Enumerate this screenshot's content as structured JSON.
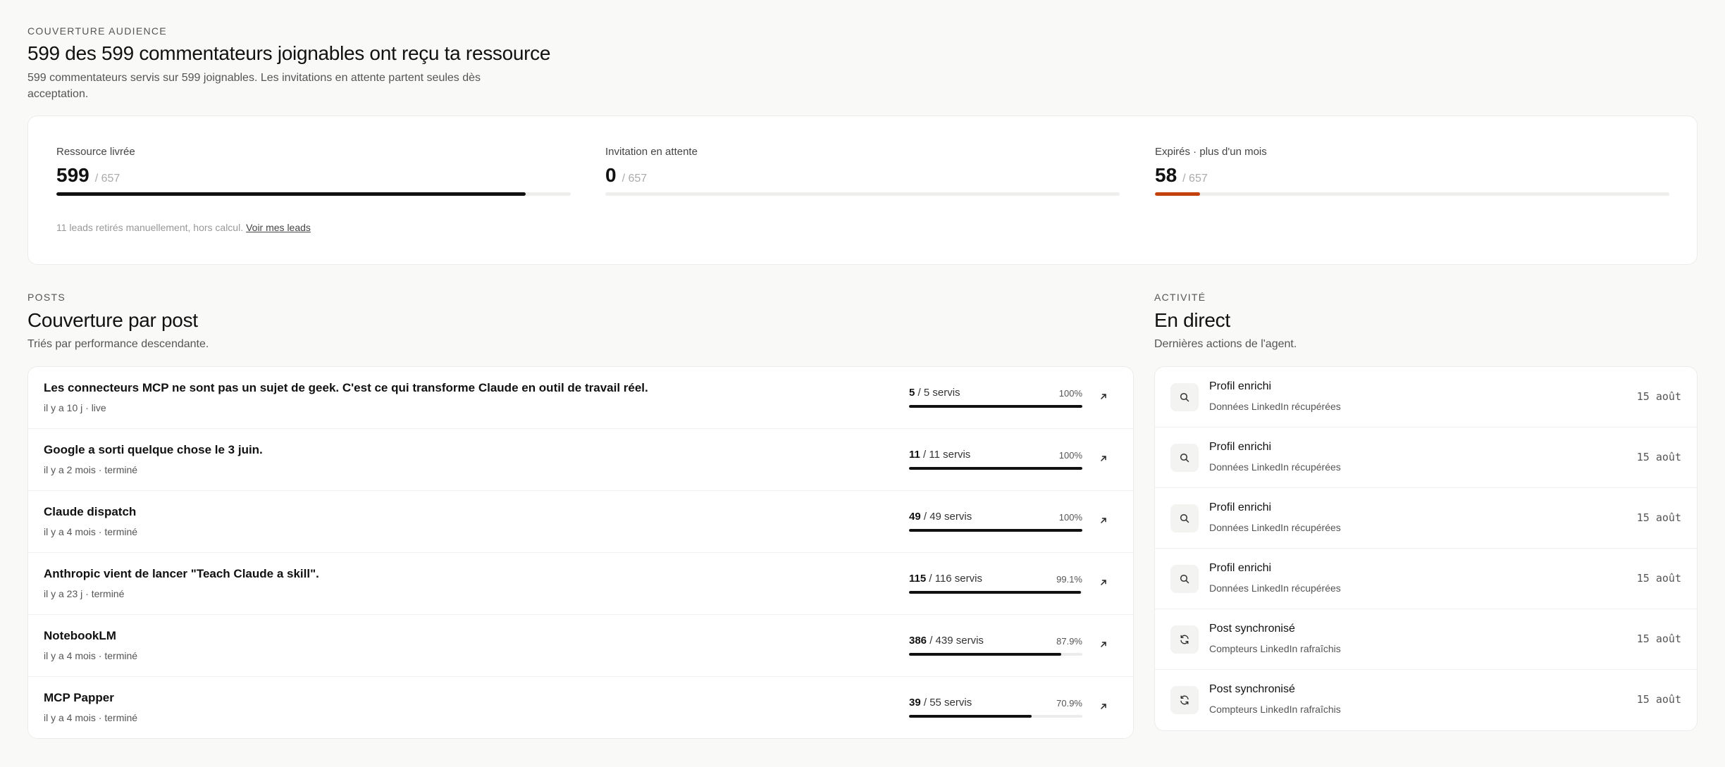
{
  "header": {
    "eyebrow": "COUVERTURE AUDIENCE",
    "title": "599 des 599 commentateurs joignables ont reçu ta ressource",
    "subtitle": "599 commentateurs servis sur 599 joignables. Les invitations en attente partent seules dès acceptation."
  },
  "stats": [
    {
      "label": "Ressource livrée",
      "value": "599",
      "total": "/ 657",
      "progress": 0.912,
      "color": "#111111"
    },
    {
      "label": "Invitation en attente",
      "value": "0",
      "total": "/ 657",
      "progress": 0,
      "color": "#111111"
    },
    {
      "label": "Expirés · plus d'un mois",
      "value": "58",
      "total": "/ 657",
      "progress": 0.088,
      "color": "#c2410c"
    }
  ],
  "stats_note": {
    "text": "11 leads retirés manuellement, hors calcul.",
    "link": "Voir mes leads"
  },
  "posts_section": {
    "eyebrow": "POSTS",
    "title": "Couverture par post",
    "subtitle": "Triés par performance descendante.",
    "items": [
      {
        "title": "Les connecteurs MCP ne sont pas un sujet de geek. C'est ce qui transforme Claude en outil de travail réel.",
        "meta": "il y a 10 j · live",
        "served": "5",
        "total": "/ 5 servis",
        "pct": "100%",
        "progress": 1.0
      },
      {
        "title": "Google a sorti quelque chose le 3 juin.",
        "meta": "il y a 2 mois · terminé",
        "served": "11",
        "total": "/ 11 servis",
        "pct": "100%",
        "progress": 1.0
      },
      {
        "title": "Claude dispatch",
        "meta": "il y a 4 mois · terminé",
        "served": "49",
        "total": "/ 49 servis",
        "pct": "100%",
        "progress": 1.0
      },
      {
        "title": "Anthropic vient de lancer \"Teach Claude a skill\".",
        "meta": "il y a 23 j · terminé",
        "served": "115",
        "total": "/ 116 servis",
        "pct": "99.1%",
        "progress": 0.991
      },
      {
        "title": "NotebookLM",
        "meta": "il y a 4 mois · terminé",
        "served": "386",
        "total": "/ 439 servis",
        "pct": "87.9%",
        "progress": 0.879
      },
      {
        "title": "MCP Papper",
        "meta": "il y a 4 mois · terminé",
        "served": "39",
        "total": "/ 55 servis",
        "pct": "70.9%",
        "progress": 0.709
      }
    ]
  },
  "activity_section": {
    "eyebrow": "ACTIVITÉ",
    "title": "En direct",
    "subtitle": "Dernières actions de l'agent.",
    "items": [
      {
        "icon": "search-icon",
        "title": "Profil enrichi",
        "desc": "Données LinkedIn récupérées",
        "date": "15 août"
      },
      {
        "icon": "search-icon",
        "title": "Profil enrichi",
        "desc": "Données LinkedIn récupérées",
        "date": "15 août"
      },
      {
        "icon": "search-icon",
        "title": "Profil enrichi",
        "desc": "Données LinkedIn récupérées",
        "date": "15 août"
      },
      {
        "icon": "search-icon",
        "title": "Profil enrichi",
        "desc": "Données LinkedIn récupérées",
        "date": "15 août"
      },
      {
        "icon": "refresh-icon",
        "title": "Post synchronisé",
        "desc": "Compteurs LinkedIn rafraîchis",
        "date": "15 août"
      },
      {
        "icon": "refresh-icon",
        "title": "Post synchronisé",
        "desc": "Compteurs LinkedIn rafraîchis",
        "date": "15 août"
      }
    ]
  }
}
